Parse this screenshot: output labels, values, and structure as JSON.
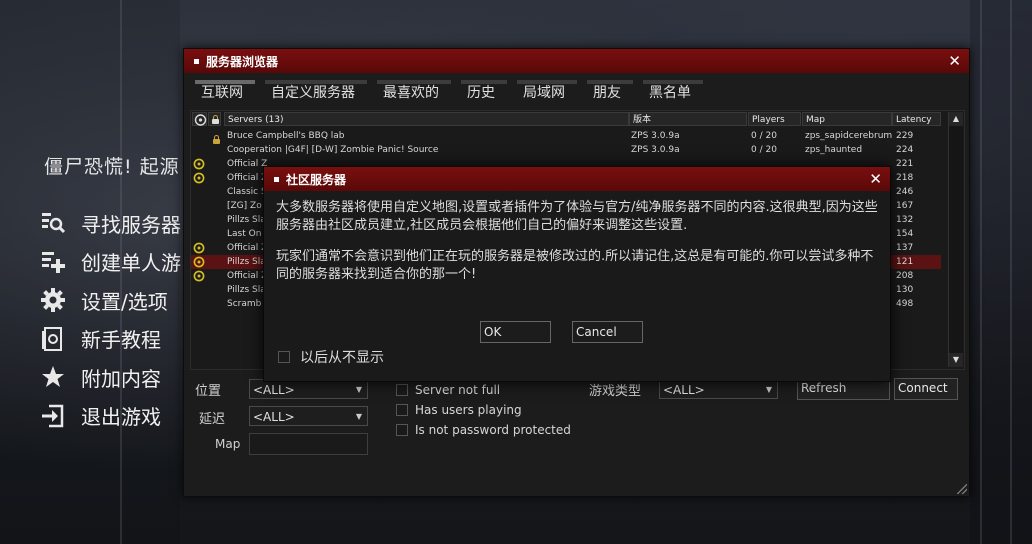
{
  "main_menu": {
    "game_title": "僵尸恐慌! 起源",
    "items": [
      {
        "label": "寻找服务器",
        "icon": "find-server-icon"
      },
      {
        "label": "创建单人游",
        "icon": "create-game-icon"
      },
      {
        "label": "设置/选项",
        "icon": "gear-icon"
      },
      {
        "label": "新手教程",
        "icon": "tutorial-icon"
      },
      {
        "label": "附加内容",
        "icon": "star-icon"
      },
      {
        "label": "退出游戏",
        "icon": "exit-icon"
      }
    ]
  },
  "server_browser": {
    "title": "服务器浏览器",
    "tabs": [
      "互联网",
      "自定义服务器",
      "最喜欢的",
      "历史",
      "局域网",
      "朋友",
      "黑名单"
    ],
    "columns": {
      "servers": "Servers (13)",
      "version": "版本",
      "players": "Players",
      "map": "Map",
      "latency": "Latency"
    },
    "rows": [
      {
        "name": "Bruce Campbell's BBQ lab",
        "version": "ZPS 3.0.9a",
        "players": "0 / 20",
        "map": "zps_sapidcerebrum",
        "latency": "229",
        "locked": true,
        "badge": false
      },
      {
        "name": "Cooperation |G4F|  [D-W] Zombie Panic! Source",
        "version": "ZPS 3.0.9a",
        "players": "0 / 20",
        "map": "zps_haunted",
        "latency": "224",
        "locked": false,
        "badge": false
      },
      {
        "name": "Official Z",
        "latency": "221",
        "badge": true
      },
      {
        "name": "Official Z",
        "latency": "218",
        "badge": true
      },
      {
        "name": "Classic S",
        "latency": "246",
        "badge": false
      },
      {
        "name": "[ZG] Zo",
        "latency": "167",
        "badge": false
      },
      {
        "name": "Pillzs Sla",
        "latency": "132",
        "badge": false
      },
      {
        "name": "Last On",
        "latency": "154",
        "badge": false
      },
      {
        "name": "Official Z",
        "latency": "137",
        "badge": true
      },
      {
        "name": "Pillzs Sla",
        "latency": "121",
        "badge": true,
        "selected": true
      },
      {
        "name": "Official Z",
        "latency": "208",
        "badge": true
      },
      {
        "name": "Pillzs Sla",
        "latency": "130",
        "badge": false
      },
      {
        "name": "Scramb",
        "latency": "498",
        "badge": false
      }
    ],
    "filters": {
      "location_label": "位置",
      "location_value": "<ALL>",
      "latency_label": "延迟",
      "latency_value": "<ALL>",
      "map_label": "Map",
      "map_value": "",
      "server_not_full": "Server not full",
      "has_users_playing": "Has users playing",
      "not_password_protected": "Is not password protected",
      "game_type_label": "游戏类型",
      "game_type_value": "<ALL>"
    },
    "refresh_label": "Refresh",
    "connect_label": "Connect"
  },
  "dialog": {
    "title": "社区服务器",
    "paragraph1": "大多数服务器将使用自定义地图,设置或者插件为了体验与官方/纯净服务器不同的内容.这很典型,因为这些服务器由社区成员建立,社区成员会根据他们自己的偏好来调整这些设置.",
    "paragraph2": "玩家们通常不会意识到他们正在玩的服务器是被修改过的.所以请记住,这总是有可能的.你可以尝试多种不同的服务器来找到适合你的那一个!",
    "ok_label": "OK",
    "cancel_label": "Cancel",
    "dont_show_label": "以后从不显示"
  },
  "colors": {
    "title_bar": "#6e0c0c",
    "selected_row": "#5a1212",
    "badge": "#d4c020"
  }
}
